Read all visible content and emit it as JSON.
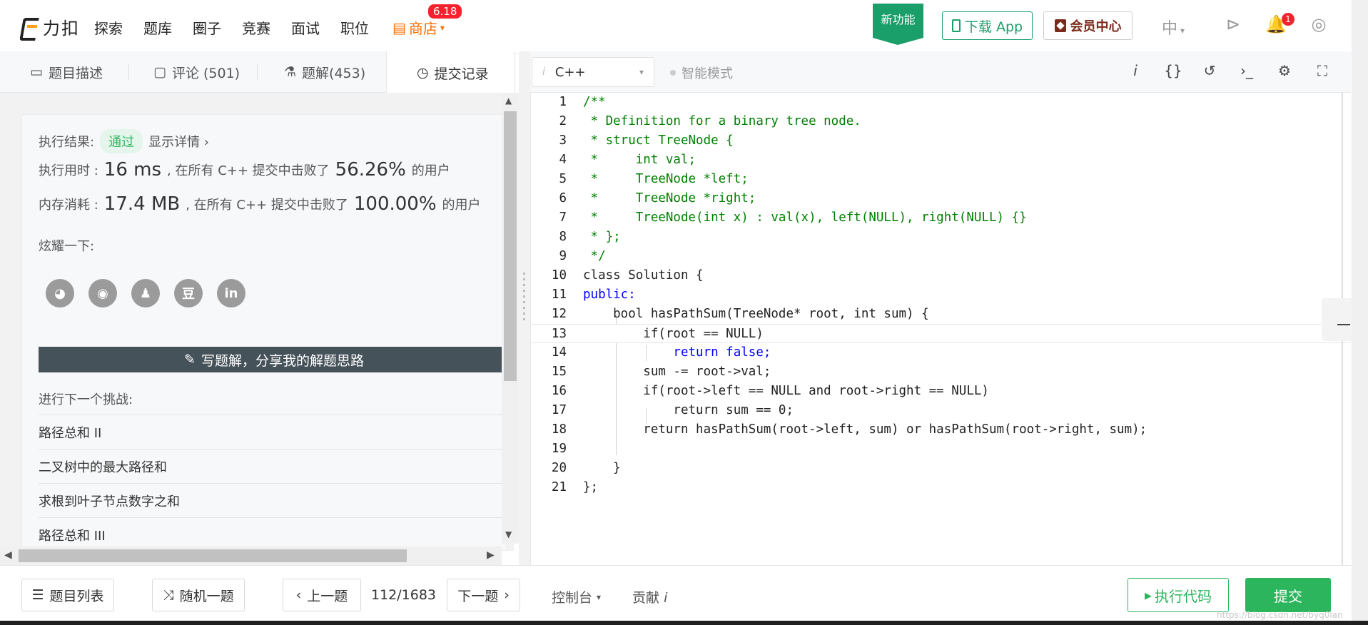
{
  "nav": {
    "logo_text": "力扣",
    "links": [
      "探索",
      "题库",
      "圈子",
      "竞赛",
      "面试",
      "职位"
    ],
    "shop_label": "商店",
    "shop_badge": "6.18",
    "new_feature": "新功能",
    "download_app": "下载 App",
    "member_center": "会员中心",
    "language": "中",
    "notification_count": "1"
  },
  "tabs": {
    "description": "题目描述",
    "comments": "评论 (501)",
    "solutions": "题解(453)",
    "submissions": "提交记录"
  },
  "result": {
    "label": "执行结果:",
    "status": "通过",
    "details_link": "显示详情 ›",
    "time_label": "执行用时 :",
    "time_value": "16 ms",
    "time_mid": ", 在所有 C++ 提交中击败了",
    "time_percent": "56.26%",
    "time_suffix": "的用户",
    "mem_label": "内存消耗 :",
    "mem_value": "17.4 MB",
    "mem_mid": ", 在所有 C++ 提交中击败了",
    "mem_percent": "100.00%",
    "mem_suffix": "的用户",
    "share_label": "炫耀一下:",
    "share_icons": [
      "wechat-icon",
      "weibo-icon",
      "qq-icon",
      "douban-icon",
      "linkedin-icon"
    ],
    "douban_glyph": "豆",
    "linkedin_glyph": "in",
    "write_solution": "写题解，分享我的解题思路",
    "next_challenge": "进行下一个挑战:",
    "next_items": [
      "路径总和 II",
      "二叉树中的最大路径和",
      "求根到叶子节点数字之和",
      "路径总和 III"
    ]
  },
  "editor": {
    "language": "C++",
    "smart_mode": "智能模式",
    "lines": [
      "/**",
      " * Definition for a binary tree node.",
      " * struct TreeNode {",
      " *     int val;",
      " *     TreeNode *left;",
      " *     TreeNode *right;",
      " *     TreeNode(int x) : val(x), left(NULL), right(NULL) {}",
      " * };",
      " */",
      "class Solution {",
      "public:",
      "    bool hasPathSum(TreeNode* root, int sum) {",
      "        if(root == NULL)",
      "            return false;",
      "        sum -= root->val;",
      "        if(root->left == NULL and root->right == NULL)",
      "            return sum == 0;",
      "        return hasPathSum(root->left, sum) or hasPathSum(root->right, sum);",
      "",
      "    }",
      "};"
    ],
    "current_line": 13
  },
  "bottom": {
    "problem_list": "题目列表",
    "random": "随机一题",
    "prev": "上一题",
    "page": "112/1683",
    "next": "下一题",
    "console": "控制台",
    "contribute": "贡献",
    "run": "执行代码",
    "submit": "提交"
  },
  "watermark": "https://blog.csdn.net/byq0lan"
}
